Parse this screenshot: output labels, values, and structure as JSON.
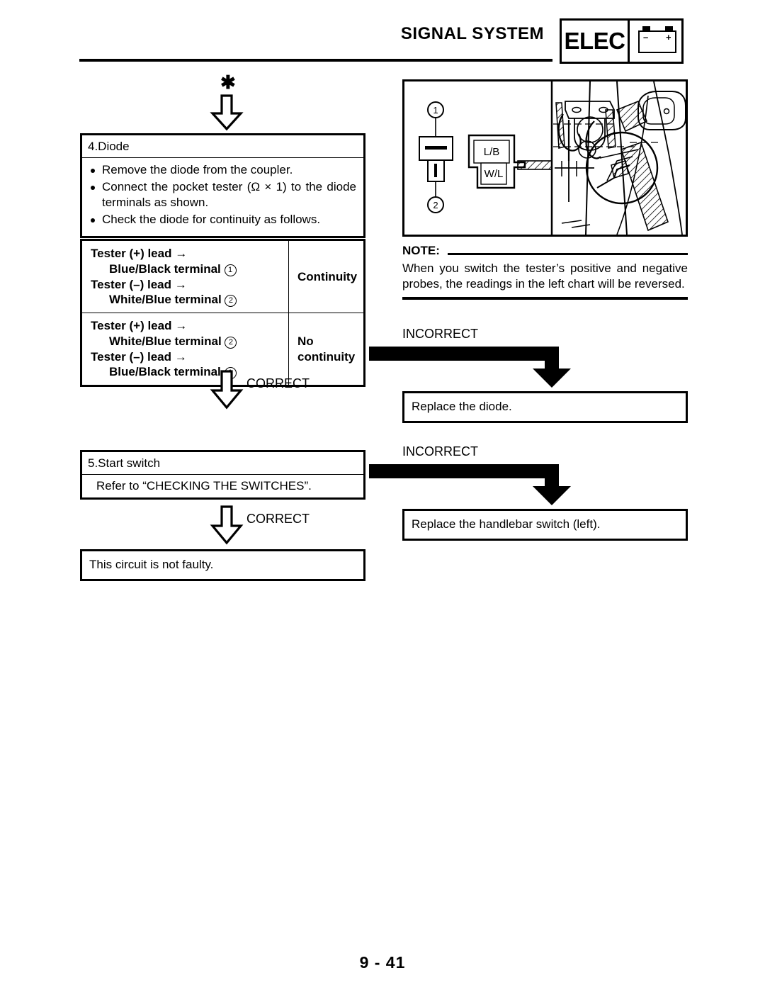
{
  "header": {
    "title": "SIGNAL SYSTEM",
    "badge_label": "ELEC",
    "battery_minus": "–",
    "battery_plus": "+"
  },
  "top_marker": {
    "star": "✱"
  },
  "diode_box": {
    "title": "4.Diode",
    "bullets": [
      "Remove the diode from the coupler.",
      "Connect the pocket tester (Ω × 1) to the diode terminals as shown.",
      "Check the diode for continuity as follows."
    ]
  },
  "continuity_table": {
    "rows": [
      {
        "line1": "Tester (+) lead →",
        "line2": "Blue/Black terminal",
        "marker2": "1",
        "line3": "Tester (–) lead →",
        "line4": "White/Blue terminal",
        "marker4": "2",
        "result": "Continuity"
      },
      {
        "line1": "Tester (+) lead →",
        "line2": "White/Blue terminal",
        "marker2": "2",
        "line3": "Tester (–) lead →",
        "line4": "Blue/Black terminal",
        "marker4": "1",
        "result": "No continuity"
      }
    ]
  },
  "flow": {
    "correct_1": "CORRECT",
    "correct_2": "CORRECT",
    "incorrect_1": "INCORRECT",
    "incorrect_2": "INCORRECT"
  },
  "start_switch_box": {
    "title": "5.Start switch",
    "body": "Refer to “CHECKING THE SWITCHES”."
  },
  "result_box": {
    "text": "This circuit is not faulty."
  },
  "replace_diode_box": {
    "text": "Replace the diode."
  },
  "replace_switch_box": {
    "text": "Replace the handlebar switch (left)."
  },
  "illustration": {
    "callout_1": "1",
    "callout_2": "2",
    "coupler_top_label": "L/B",
    "coupler_bottom_label": "W/L"
  },
  "note": {
    "label": "NOTE:",
    "text": "When you switch the tester’s positive and negative probes, the readings in the left chart will be reversed."
  },
  "page": {
    "number": "9 - 41"
  }
}
